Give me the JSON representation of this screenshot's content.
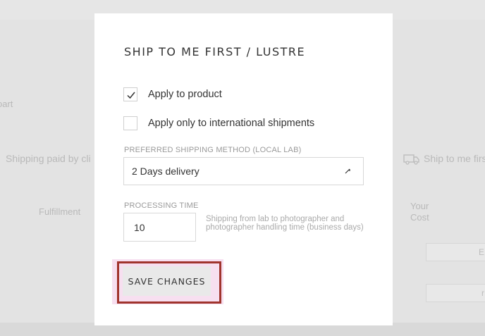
{
  "background": {
    "left_cut_text": "oart",
    "shipping_paid_text": "Shipping paid by cli",
    "fulfillment_text": "Fulfillment",
    "ship_first_text": "Ship to me firs",
    "your_cost_text": "Your Cost",
    "box1_text": "E",
    "box2_text": "r"
  },
  "modal": {
    "title": "SHIP TO ME FIRST / LUSTRE",
    "apply_product": {
      "label": "Apply to product",
      "checked": true
    },
    "apply_international": {
      "label": "Apply only to international shipments",
      "checked": false
    },
    "shipping_method": {
      "label": "PREFERRED SHIPPING METHOD (LOCAL LAB)",
      "value": "2 Days delivery"
    },
    "processing_time": {
      "label": "PROCESSING TIME",
      "value": "10",
      "help": "Shipping from lab to photographer and photographer handling time (business days)"
    },
    "save_label": "SAVE CHANGES"
  },
  "colors": {
    "highlight": "#f7dff0",
    "outline": "#a0342d",
    "button_bg": "#e9e9e9"
  }
}
